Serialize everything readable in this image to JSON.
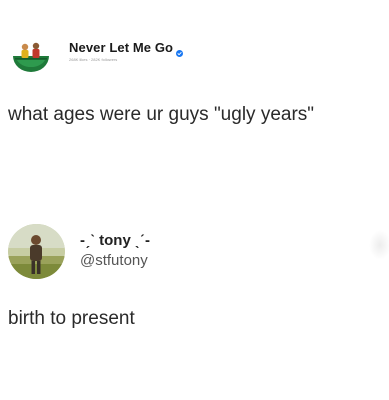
{
  "page": {
    "name": "Never Let Me Go",
    "stats": "268K likes · 282K followers",
    "verified_icon": "verified-badge-icon",
    "accent_color": "#1877f2"
  },
  "post": {
    "question": "what ages were ur guys \"ugly years\""
  },
  "reply": {
    "display_name": "-ˏˋ tony ˎˊ-",
    "handle": "@stfutony",
    "text": "birth to present"
  }
}
